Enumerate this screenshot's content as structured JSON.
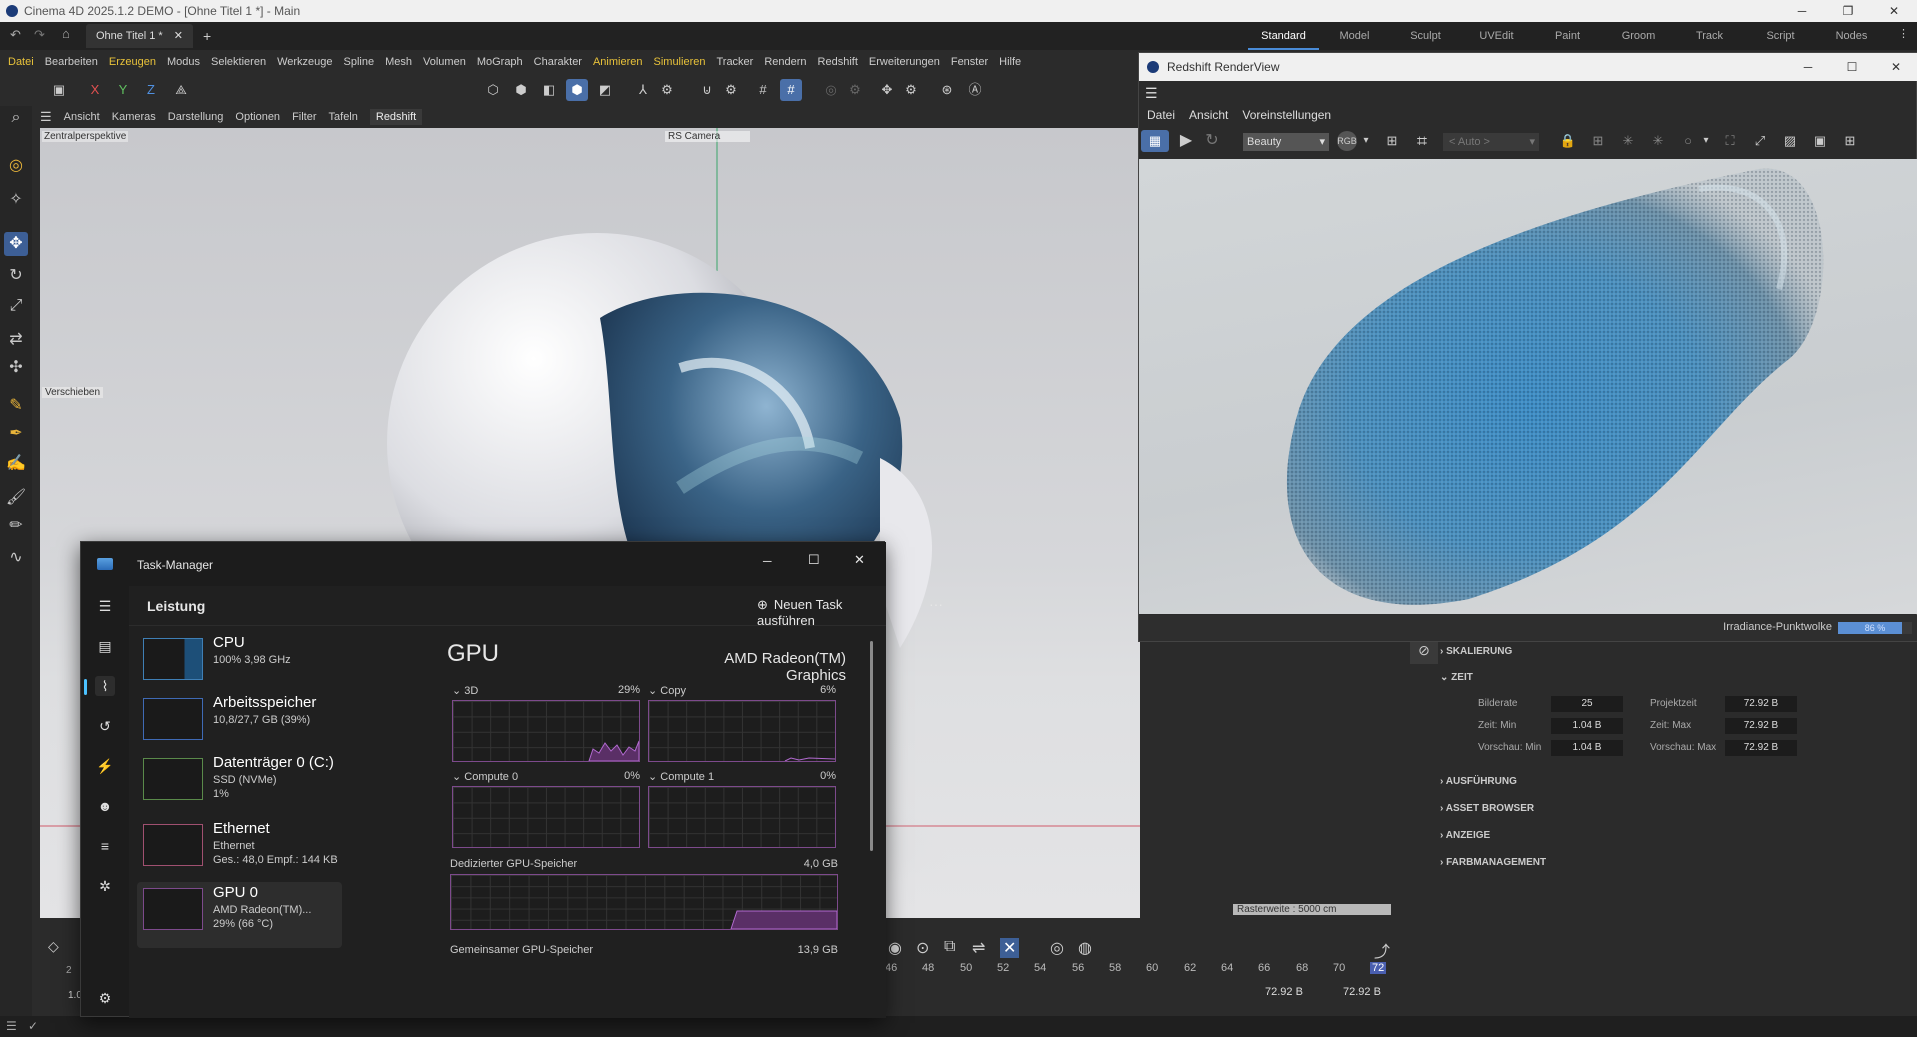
{
  "window": {
    "title": "Cinema 4D 2025.1.2 DEMO - [Ohne Titel 1 *] - Main"
  },
  "tab": {
    "label": "Ohne Titel 1 *"
  },
  "layouts": [
    "Standard",
    "Model",
    "Sculpt",
    "UVEdit",
    "Paint",
    "Groom",
    "Track",
    "Script",
    "Nodes"
  ],
  "menu": [
    "Datei",
    "Bearbeiten",
    "Erzeugen",
    "Modus",
    "Selektieren",
    "Werkzeuge",
    "Spline",
    "Mesh",
    "Volumen",
    "MoGraph",
    "Charakter",
    "Animieren",
    "Simulieren",
    "Tracker",
    "Rendern",
    "Redshift",
    "Erweiterungen",
    "Fenster",
    "Hilfe"
  ],
  "axes": [
    "X",
    "Y",
    "Z"
  ],
  "viewport_menu": [
    "Ansicht",
    "Kameras",
    "Darstellung",
    "Optionen",
    "Filter",
    "Tafeln",
    "Redshift"
  ],
  "viewport": {
    "label": "Zentralperspektive",
    "camera": "RS Camera",
    "tool": "Verschieben",
    "raster": "Rasterweite : 5000 cm"
  },
  "timeline": {
    "ticks": [
      "46",
      "48",
      "50",
      "52",
      "54",
      "56",
      "58",
      "60",
      "62",
      "64",
      "66",
      "68",
      "70",
      "72"
    ],
    "value1": "72.92 B",
    "value2": "72.92 B",
    "left_tick": "2",
    "left_val": "1.0"
  },
  "attributes": {
    "sections": [
      "SKALIERUNG",
      "ZEIT",
      "AUSFÜHRUNG",
      "ASSET BROWSER",
      "ANZEIGE",
      "FARBMANAGEMENT"
    ],
    "fields": [
      {
        "label": "Bilderate",
        "value": "25"
      },
      {
        "label": "Projektzeit",
        "value": "72.92 B"
      },
      {
        "label": "Zeit: Min",
        "value": "1.04 B"
      },
      {
        "label": "Zeit: Max",
        "value": "72.92 B"
      },
      {
        "label": "Vorschau: Min",
        "value": "1.04 B"
      },
      {
        "label": "Vorschau: Max",
        "value": "72.92 B"
      }
    ]
  },
  "renderview": {
    "title": "Redshift RenderView",
    "menu": [
      "Datei",
      "Ansicht",
      "Voreinstellungen"
    ],
    "aov": "Beauty",
    "auto": "< Auto >",
    "status": "Irradiance-Punktwolke",
    "progress_pct": "86 %",
    "progress": 0.86
  },
  "taskmanager": {
    "title": "Task-Manager",
    "section": "Leistung",
    "new_task": "Neuen Task ausführen",
    "items": [
      {
        "name": "CPU",
        "sub1": "100% 3,98 GHz",
        "sub2": ""
      },
      {
        "name": "Arbeitsspeicher",
        "sub1": "10,8/27,7 GB (39%)",
        "sub2": ""
      },
      {
        "name": "Datenträger 0 (C:)",
        "sub1": "SSD (NVMe)",
        "sub2": "1%"
      },
      {
        "name": "Ethernet",
        "sub1": "Ethernet",
        "sub2": "Ges.: 48,0 Empf.: 144 KB"
      },
      {
        "name": "GPU 0",
        "sub1": "AMD Radeon(TM)...",
        "sub2": "29% (66 °C)"
      }
    ],
    "gpu": {
      "heading": "GPU",
      "model": "AMD Radeon(TM) Graphics",
      "engines": [
        {
          "name": "3D",
          "pct": "29%"
        },
        {
          "name": "Copy",
          "pct": "6%"
        },
        {
          "name": "Compute 0",
          "pct": "0%"
        },
        {
          "name": "Compute 1",
          "pct": "0%"
        }
      ],
      "dedicated": {
        "label": "Dedizierter GPU-Speicher",
        "value": "4,0 GB"
      },
      "shared": {
        "label": "Gemeinsamer GPU-Speicher",
        "value": "13,9 GB"
      }
    }
  }
}
